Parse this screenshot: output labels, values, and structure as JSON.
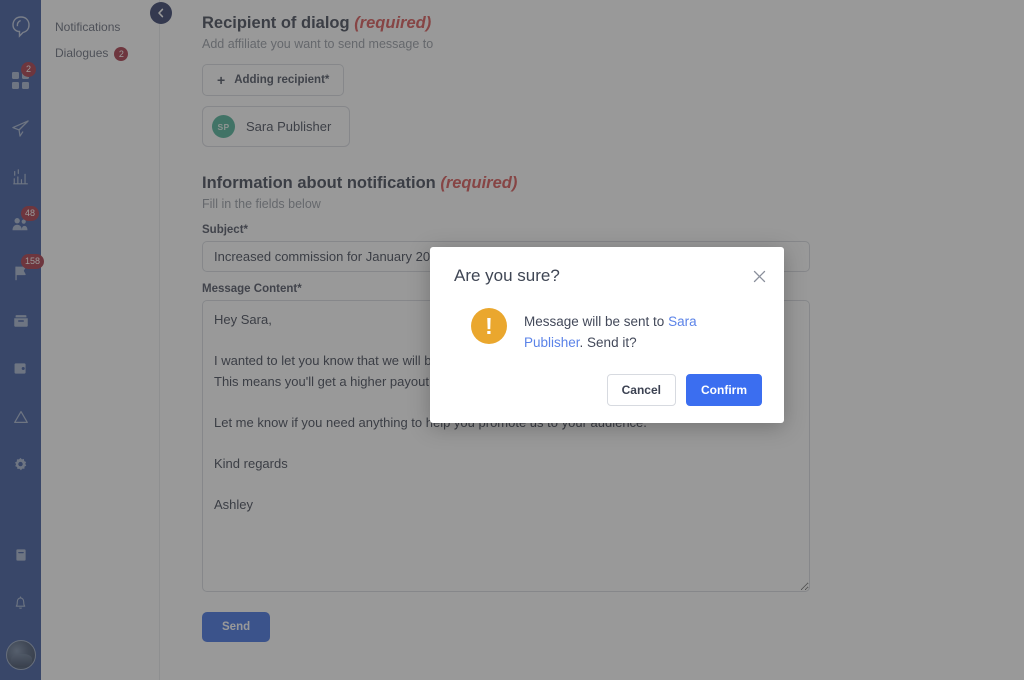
{
  "rail": {
    "logo_icon": "brand-logo-icon",
    "items": [
      {
        "icon": "grid-dashboard-icon",
        "badge": "2"
      },
      {
        "icon": "paper-plane-icon",
        "badge": ""
      },
      {
        "icon": "bar-chart-icon",
        "badge": ""
      },
      {
        "icon": "users-group-icon",
        "badge": "48"
      },
      {
        "icon": "flag-icon",
        "badge": "158"
      },
      {
        "icon": "inbox-icon",
        "badge": ""
      },
      {
        "icon": "wallet-icon",
        "badge": ""
      },
      {
        "icon": "triangle-alert-icon",
        "badge": ""
      },
      {
        "icon": "gear-icon",
        "badge": ""
      }
    ],
    "bottom_items": [
      {
        "icon": "book-icon",
        "badge": ""
      },
      {
        "icon": "bell-icon",
        "badge": ""
      }
    ],
    "avatar_icon": "user-avatar"
  },
  "subnav": {
    "items": [
      {
        "label": "Notifications",
        "badge": ""
      },
      {
        "label": "Dialogues",
        "badge": "2"
      }
    ],
    "collapse_icon": "chevron-left-icon"
  },
  "recipient_section": {
    "title": "Recipient of dialog",
    "required_tag": "(required)",
    "subtitle": "Add affiliate you want to send message to",
    "add_button_label": "Adding recipient*",
    "add_button_icon": "plus-icon",
    "chip": {
      "initials": "SP",
      "name": "Sara Publisher"
    }
  },
  "notification_section": {
    "title": "Information about notification",
    "required_tag": "(required)",
    "subtitle": "Fill in the fields below",
    "subject_label": "Subject*",
    "subject_value": "Increased commission for January 2024",
    "subject_placeholder": "Subject",
    "message_label": "Message Content*",
    "message_value": "Hey Sara,\n\nI wanted to let you know that we will be increasing your commission for the month of January 2024. This means you'll get a higher payout on every conversion.\n\nLet me know if you need anything to help you promote us to your audience.\n\nKind regards\n\nAshley",
    "message_placeholder": "Message Content",
    "send_button_label": "Send"
  },
  "modal": {
    "title": "Are you sure?",
    "close_icon": "close-icon",
    "warn_icon": "exclamation-icon",
    "warn_glyph": "!",
    "text_before": "Message will be sent to ",
    "link_text": "Sara Publisher",
    "text_after": ". Send it?",
    "cancel_label": "Cancel",
    "confirm_label": "Confirm"
  },
  "colors": {
    "rail_blue": "#2b4a96",
    "badge_red": "#a02535",
    "required_red": "#d64545",
    "chip_avatar_teal": "#3cab8e",
    "warn_amber": "#eaa72e",
    "link_blue": "#5b83e8",
    "confirm_blue": "#3b6ef0",
    "send_blue": "#2f64e0",
    "overlay": "rgba(70,70,70,0.55)"
  }
}
